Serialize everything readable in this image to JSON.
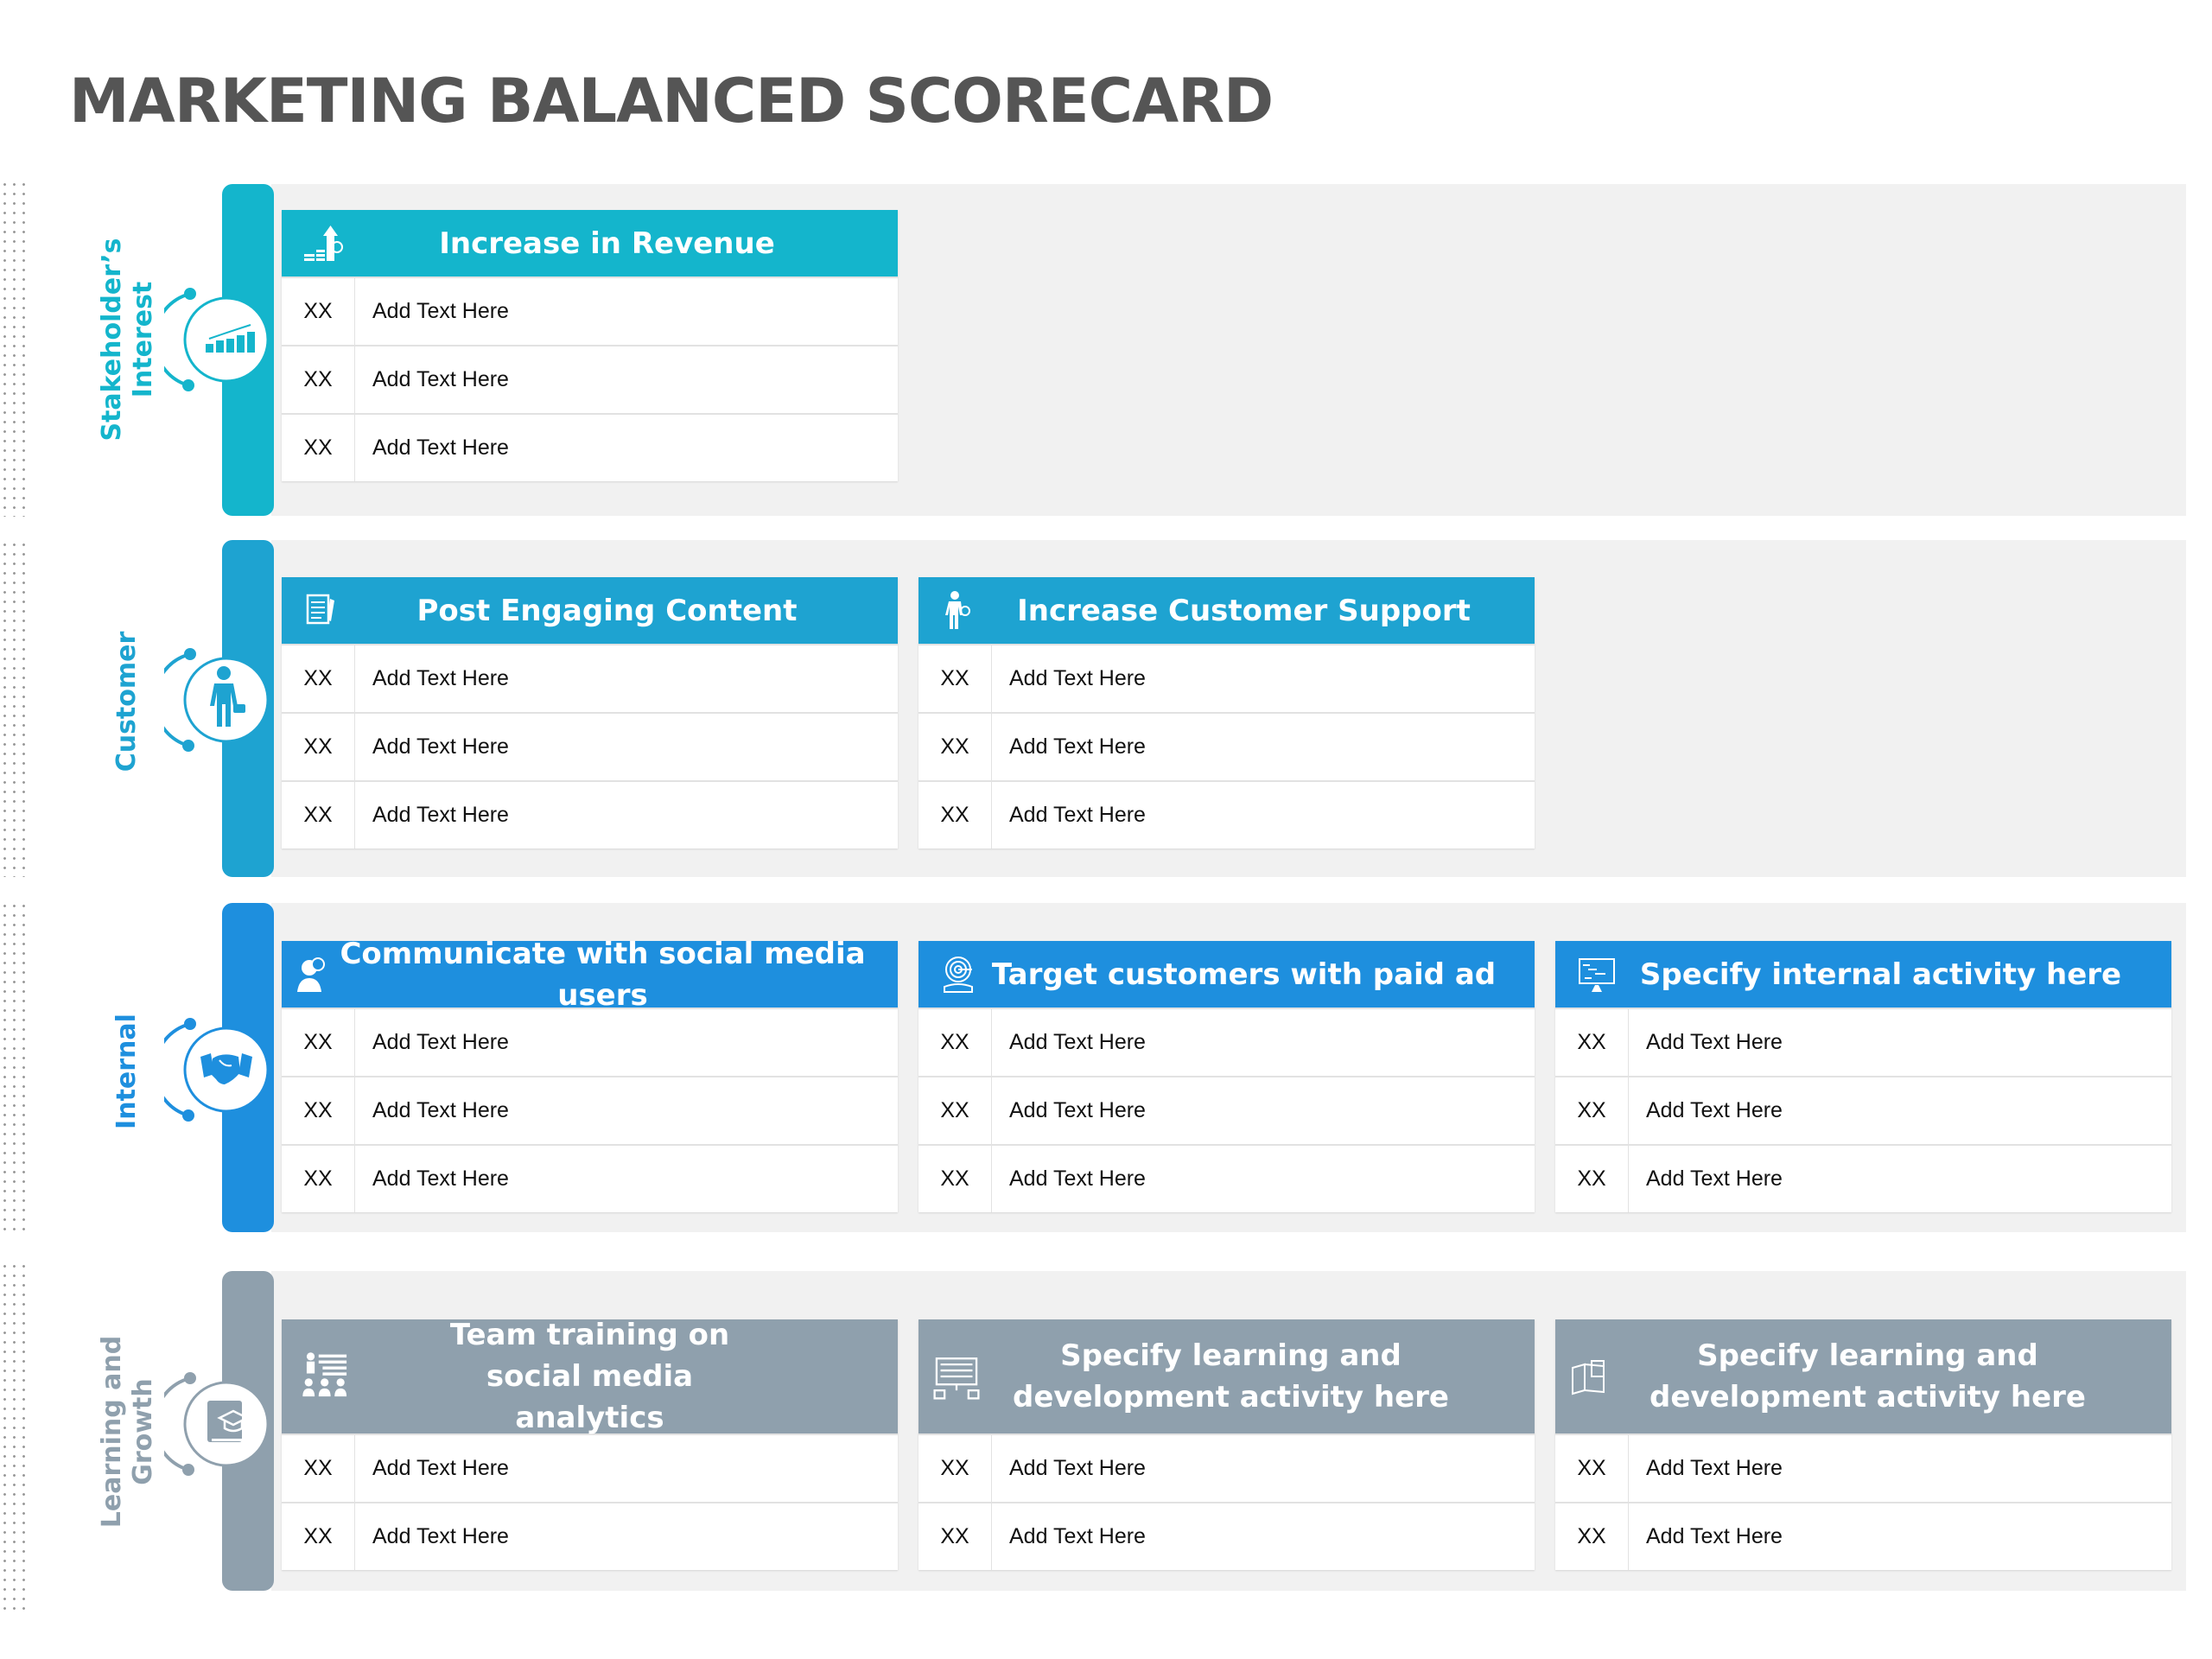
{
  "title": "MARKETING BALANCED SCORECARD",
  "colors": {
    "stakeholder": "#14b5cc",
    "customer": "#1ea3d1",
    "internal": "#1e8fde",
    "learning": "#8fa0ad",
    "title": "#555555",
    "section_bg": "#f1f1f1"
  },
  "sections": [
    {
      "label": "Stakeholder’s\nInterest",
      "label_line1": "Stakeholder’s",
      "label_line2": "Interest",
      "icon": "growth-chart-icon",
      "cards": [
        {
          "title": "Increase in Revenue",
          "icon": "revenue-growth-icon",
          "rows": [
            {
              "code": "XX",
              "text": "Add Text Here"
            },
            {
              "code": "XX",
              "text": "Add Text Here"
            },
            {
              "code": "XX",
              "text": "Add Text Here"
            }
          ]
        }
      ]
    },
    {
      "label_line1": "Customer",
      "icon": "shopper-icon",
      "cards": [
        {
          "title": "Post Engaging Content",
          "icon": "document-icon",
          "rows": [
            {
              "code": "XX",
              "text": "Add Text Here"
            },
            {
              "code": "XX",
              "text": "Add Text Here"
            },
            {
              "code": "XX",
              "text": "Add Text Here"
            }
          ]
        },
        {
          "title": "Increase Customer Support",
          "icon": "support-person-icon",
          "rows": [
            {
              "code": "XX",
              "text": "Add Text Here"
            },
            {
              "code": "XX",
              "text": "Add Text Here"
            },
            {
              "code": "XX",
              "text": "Add Text Here"
            }
          ]
        }
      ]
    },
    {
      "label_line1": "Internal",
      "icon": "handshake-icon",
      "cards": [
        {
          "title": "Communicate with social media users",
          "icon": "chat-user-icon",
          "rows": [
            {
              "code": "XX",
              "text": "Add Text Here"
            },
            {
              "code": "XX",
              "text": "Add Text Here"
            },
            {
              "code": "XX",
              "text": "Add Text Here"
            }
          ]
        },
        {
          "title": "Target customers with paid ad",
          "icon": "target-icon",
          "rows": [
            {
              "code": "XX",
              "text": "Add Text Here"
            },
            {
              "code": "XX",
              "text": "Add Text Here"
            },
            {
              "code": "XX",
              "text": "Add Text Here"
            }
          ]
        },
        {
          "title": "Specify internal activity here",
          "icon": "monitor-chart-icon",
          "rows": [
            {
              "code": "XX",
              "text": "Add Text Here"
            },
            {
              "code": "XX",
              "text": "Add Text Here"
            },
            {
              "code": "XX",
              "text": "Add Text Here"
            }
          ]
        }
      ]
    },
    {
      "label_line1": "Learning and",
      "label_line2": "Growth",
      "icon": "graduation-book-icon",
      "cards": [
        {
          "title": "Team training on social media analytics",
          "icon": "classroom-icon",
          "rows": [
            {
              "code": "XX",
              "text": "Add Text Here"
            },
            {
              "code": "XX",
              "text": "Add Text Here"
            }
          ]
        },
        {
          "title": "Specify learning and development activity here",
          "icon": "presentation-board-icon",
          "rows": [
            {
              "code": "XX",
              "text": "Add Text Here"
            },
            {
              "code": "XX",
              "text": "Add Text Here"
            }
          ]
        },
        {
          "title": "Specify learning and development activity here",
          "icon": "online-book-icon",
          "rows": [
            {
              "code": "XX",
              "text": "Add Text Here"
            },
            {
              "code": "XX",
              "text": "Add Text Here"
            }
          ]
        }
      ]
    }
  ]
}
